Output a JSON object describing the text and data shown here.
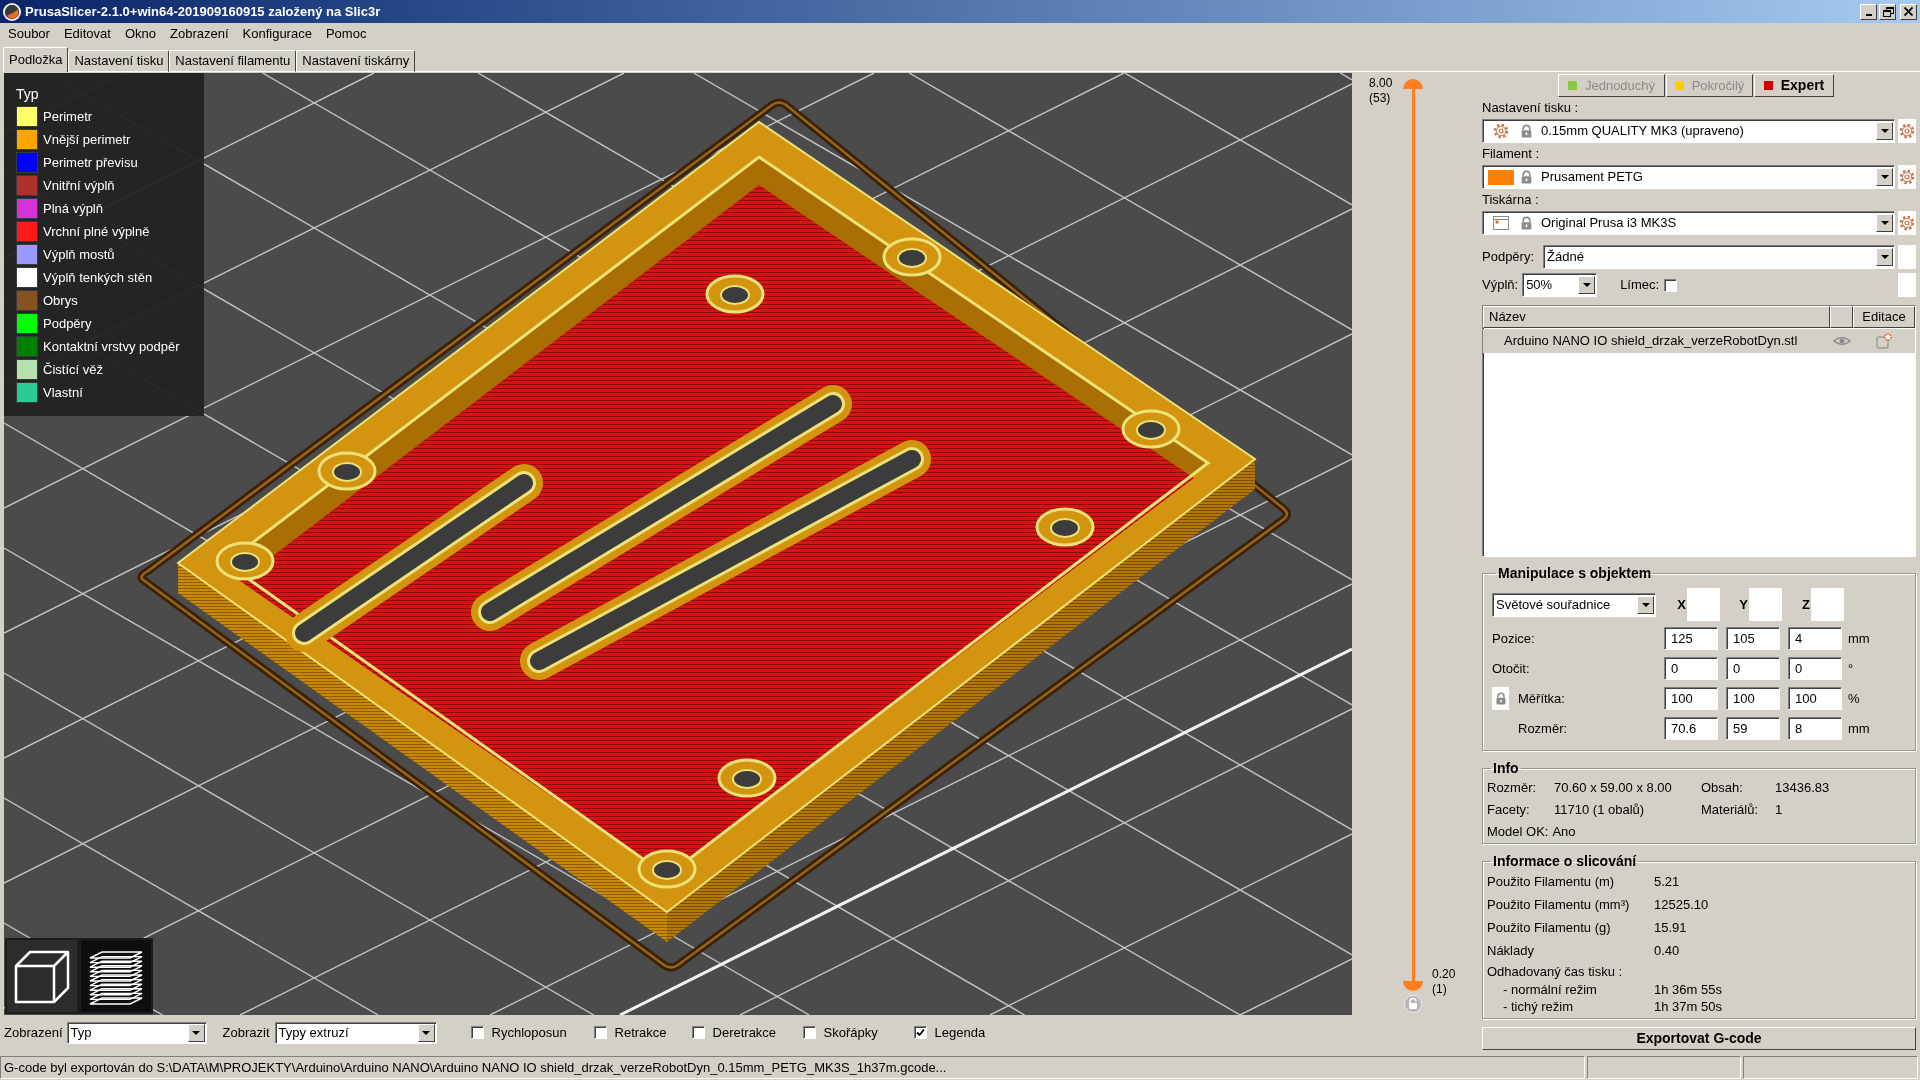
{
  "window": {
    "title": "PrusaSlicer-2.1.0+win64-201909160915 založený na Slic3r"
  },
  "menu": [
    "Soubor",
    "Editovat",
    "Okno",
    "Zobrazení",
    "Konfigurace",
    "Pomoc"
  ],
  "tabs": [
    {
      "label": "Podložka",
      "selected": true
    },
    {
      "label": "Nastavení tisku",
      "selected": false
    },
    {
      "label": "Nastavení filamentu",
      "selected": false
    },
    {
      "label": "Nastavení tiskárny",
      "selected": false
    }
  ],
  "legend": {
    "title": "Typ",
    "items": [
      {
        "label": "Perimetr",
        "color": "#ffff68"
      },
      {
        "label": "Vnější perimetr",
        "color": "#ffa500"
      },
      {
        "label": "Perimetr převisu",
        "color": "#0000ff"
      },
      {
        "label": "Vnitřní výplň",
        "color": "#b0302a"
      },
      {
        "label": "Plná výplň",
        "color": "#d633d6"
      },
      {
        "label": "Vrchní plné výplně",
        "color": "#ff1a1a"
      },
      {
        "label": "Výplň mostů",
        "color": "#9999ff"
      },
      {
        "label": "Výplň tenkých stěn",
        "color": "#ffffff"
      },
      {
        "label": "Obrys",
        "color": "#845321"
      },
      {
        "label": "Podpěry",
        "color": "#00ff00"
      },
      {
        "label": "Kontaktní vrstvy podpěr",
        "color": "#008000"
      },
      {
        "label": "Čistící věž",
        "color": "#b3e3ab"
      },
      {
        "label": "Vlastní",
        "color": "#28cc94"
      }
    ]
  },
  "view_buttons": [
    {
      "kind": "editor",
      "selected": false
    },
    {
      "kind": "preview",
      "selected": true
    }
  ],
  "bottom_toolbar": {
    "view": {
      "label": "Zobrazení",
      "value": "Typ"
    },
    "show": {
      "label": "Zobrazit",
      "value": "Typy extruzí"
    },
    "checkboxes": [
      {
        "label": "Rychloposun",
        "checked": false
      },
      {
        "label": "Retrakce",
        "checked": false
      },
      {
        "label": "Deretrakce",
        "checked": false
      },
      {
        "label": "Skořápky",
        "checked": false
      },
      {
        "label": "Legenda",
        "checked": true
      }
    ]
  },
  "layer_slider": {
    "top_value": "8.00",
    "top_layer": "(53)",
    "bottom_value": "0.20",
    "bottom_layer": "(1)"
  },
  "modes": [
    {
      "label": "Jednoduchý",
      "color": "#8cc63f",
      "selected": false
    },
    {
      "label": "Pokročilý",
      "color": "#ffcc00",
      "selected": false
    },
    {
      "label": "Expert",
      "color": "#cc0000",
      "selected": true
    }
  ],
  "presets": [
    {
      "kind": "print",
      "label": "Nastavení tisku :",
      "value": "0.15mm QUALITY MK3 (upraveno)"
    },
    {
      "kind": "filament",
      "label": "Filament :",
      "value": "Prusament PETG",
      "color": "#ff8000"
    },
    {
      "kind": "printer",
      "label": "Tiskárna :",
      "value": "Original Prusa i3 MK3S"
    }
  ],
  "supports": {
    "label": "Podpěry:",
    "value": "Žádné"
  },
  "infill": {
    "label": "Výplň:",
    "value": "50%"
  },
  "brim": {
    "label": "Límec:",
    "checked": false
  },
  "object_list": {
    "columns": [
      "Název",
      "Editace"
    ],
    "rows": [
      {
        "name": "Arduino NANO IO shield_drzak_verzeRobotDyn.stl",
        "selected": true
      }
    ]
  },
  "manipulation": {
    "title": "Manipulace s objektem",
    "coordinates": "Světové souřadnice",
    "axes": [
      "X",
      "Y",
      "Z"
    ],
    "rows": [
      {
        "kind": "plain",
        "label": "Pozice:",
        "values": [
          "125",
          "105",
          "4"
        ],
        "unit": "mm"
      },
      {
        "kind": "plain",
        "label": "Otočit:",
        "values": [
          "0",
          "0",
          "0"
        ],
        "unit": "°"
      },
      {
        "kind": "locked",
        "label": "Měřítka:",
        "values": [
          "100",
          "100",
          "100"
        ],
        "unit": "%"
      },
      {
        "kind": "indented",
        "label": "Rozměr:",
        "values": [
          "70.6",
          "59",
          "8"
        ],
        "unit": "mm"
      }
    ]
  },
  "info": {
    "title": "Info",
    "rows": [
      {
        "kind": "pairs",
        "items": [
          {
            "label": "Rozměr:",
            "value": "70.60 x 59.00 x 8.00"
          },
          {
            "label": "Obsah:",
            "value": "13436.83"
          }
        ]
      },
      {
        "kind": "pairs",
        "items": [
          {
            "label": "Facety:",
            "value": "11710 (1 obalů)"
          },
          {
            "label": "Materiálů:",
            "value": "1"
          }
        ]
      },
      {
        "kind": "inline",
        "items": [
          {
            "label": "Model OK:",
            "value": "Ano"
          }
        ]
      }
    ]
  },
  "slicing_info": {
    "title": "Informace o slicování",
    "rows": [
      {
        "kind": "value",
        "label": "Použito Filamentu (m)",
        "value": "5.21"
      },
      {
        "kind": "value",
        "label": "Použito Filamentu (mm³)",
        "value": "12525.10"
      },
      {
        "kind": "value",
        "label": "Použito Filamentu (g)",
        "value": "15.91"
      },
      {
        "kind": "value",
        "label": "Náklady",
        "value": "0.40"
      },
      {
        "kind": "heading",
        "label": "Odhadovaný čas tisku :"
      },
      {
        "kind": "sub",
        "label": "- normální režim",
        "value": "1h 36m 55s"
      },
      {
        "kind": "sub",
        "label": "- tichý režim",
        "value": "1h 37m 50s"
      }
    ]
  },
  "export_button": "Exportovat G-code",
  "status_bar": {
    "message": "G-code byl exportován do S:\\DATA\\M\\PROJEKTY\\Arduino\\Arduino NANO\\Arduino NANO IO shield_drzak_verzeRobotDyn_0.15mm_PETG_MK3S_1h37m.gcode..."
  }
}
